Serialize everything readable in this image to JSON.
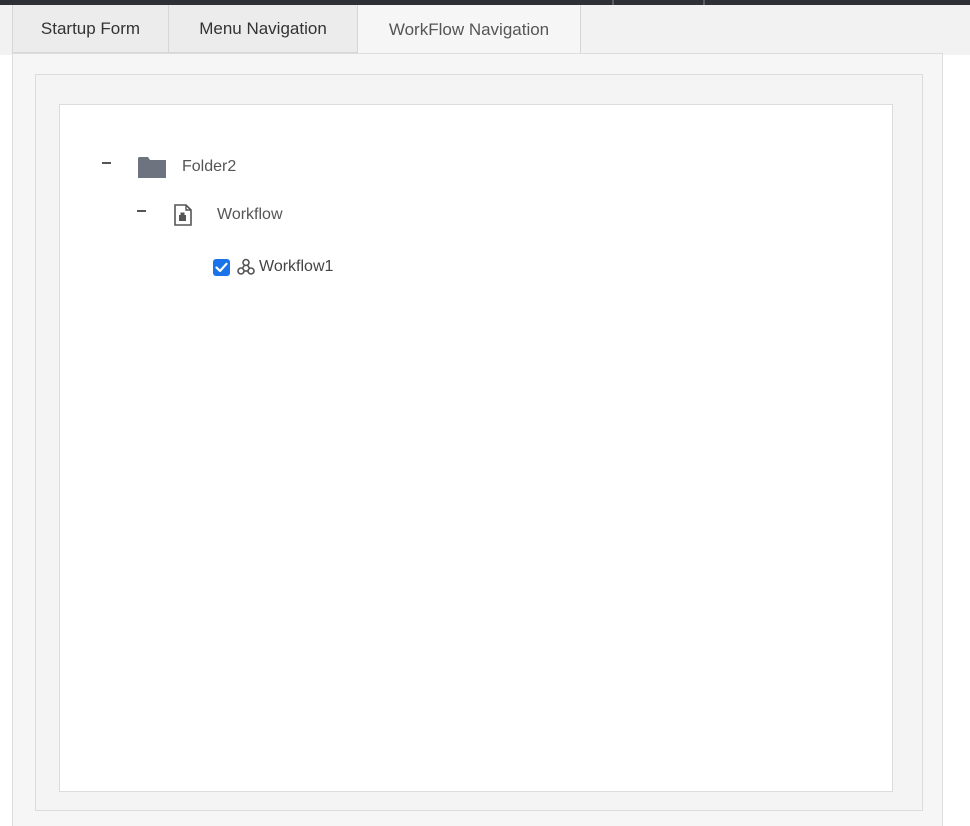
{
  "tabs": [
    {
      "label": "Startup Form",
      "active": false
    },
    {
      "label": "Menu Navigation",
      "active": false
    },
    {
      "label": "WorkFlow Navigation",
      "active": true
    }
  ],
  "tree": {
    "folder": {
      "label": "Folder2",
      "expanded": true,
      "icon": "folder-icon"
    },
    "category": {
      "label": "Workflow",
      "expanded": true,
      "icon": "document-icon"
    },
    "item": {
      "label": "Workflow1",
      "checked": true,
      "icon": "workflow-icon"
    }
  },
  "colors": {
    "checkbox": "#1a73e8",
    "folder": "#6e7380",
    "text": "#555555"
  }
}
